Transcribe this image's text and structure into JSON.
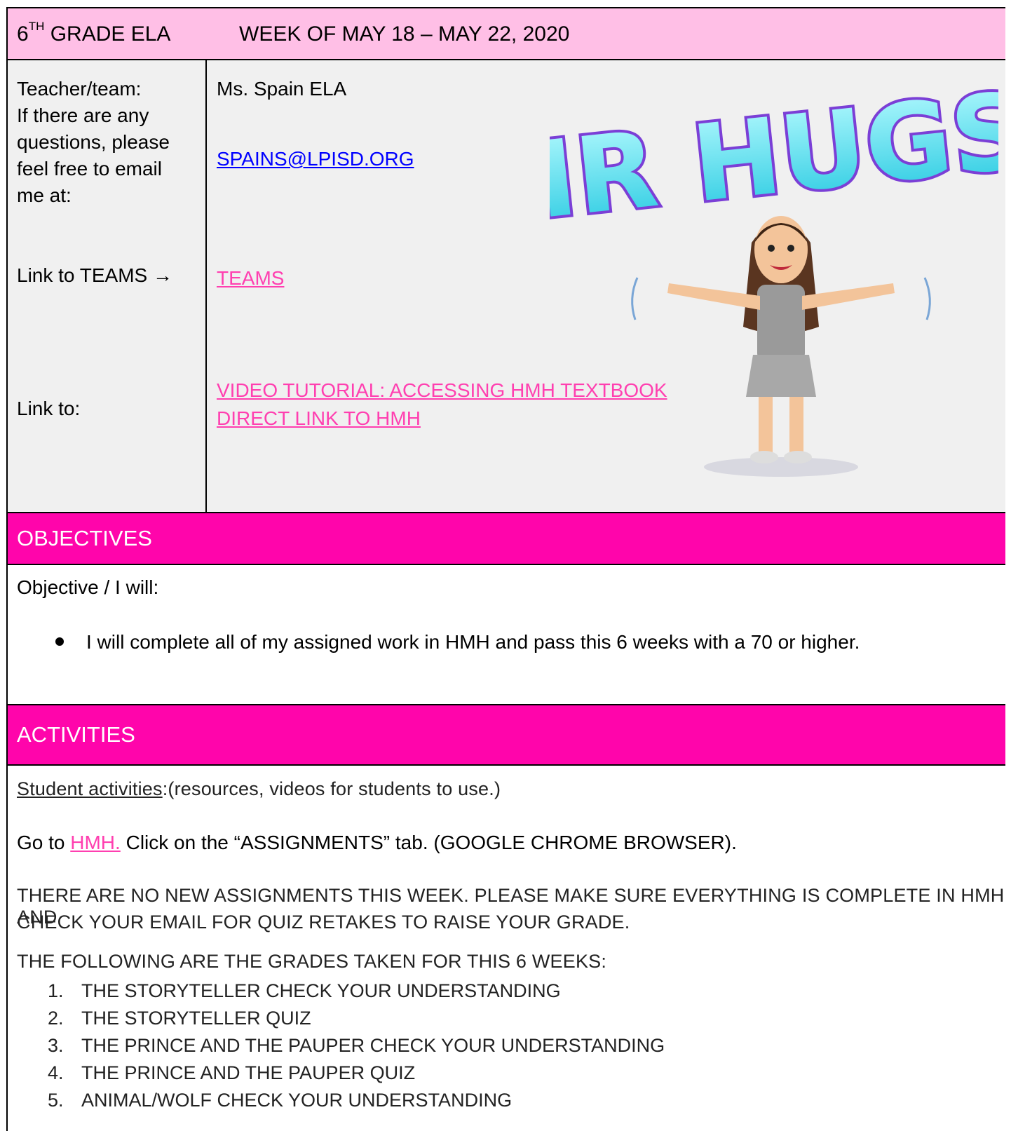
{
  "header": {
    "grade": "6",
    "grade_sup": "TH",
    "grade_rest": " GRADE ELA",
    "week": "WEEK OF MAY 18 – MAY 22, 2020"
  },
  "info": {
    "teacher_label": "Teacher/team:\nIf there are any questions, please feel free to email me at:",
    "teacher_value": "Ms. Spain ELA",
    "email": "SPAINS@LPISD.ORG",
    "teams_label": "Link to TEAMS →",
    "teams_link": "TEAMS",
    "link_to_label": "Link to:",
    "video_link": "VIDEO TUTORIAL: ACCESSING HMH TEXTBOOK",
    "direct_link": "DIRECT LINK TO HMH"
  },
  "sticker": {
    "text": "AIR HUGS!",
    "colors": {
      "letters": "#2fe0e8",
      "outline": "#7b3fd6"
    }
  },
  "objectives": {
    "title": "OBJECTIVES",
    "heading": "Objective / I will:",
    "bullet": "I will complete all of my assigned work in HMH and pass this 6 weeks with a 70 or higher."
  },
  "activities": {
    "title": "ACTIVITIES",
    "student_label": "Student activities",
    "student_rest": ":(resources, videos for students to use.)",
    "goto_pre": "Go to ",
    "goto_link": "HMH.",
    "goto_post": " Click on the “ASSIGNMENTS” tab. (GOOGLE CHROME BROWSER).",
    "notice_line1": "THERE ARE NO NEW ASSIGNMENTS THIS WEEK. PLEASE MAKE SURE EVERYTHING IS COMPLETE IN HMH AND",
    "notice_line2": "CHECK YOUR EMAIL FOR QUIZ RETAKES TO RAISE YOUR GRADE.",
    "grades_intro": "THE FOLLOWING ARE THE GRADES TAKEN FOR THIS 6 WEEKS:",
    "grades": [
      {
        "n": "1.",
        "text": "THE STORYTELLER CHECK YOUR UNDERSTANDING"
      },
      {
        "n": "2.",
        "text": "THE STORYTELLER QUIZ"
      },
      {
        "n": "3.",
        "text": "THE PRINCE AND THE PAUPER CHECK YOUR UNDERSTANDING"
      },
      {
        "n": "4.",
        "text": "THE PRINCE AND THE PAUPER QUIZ"
      },
      {
        "n": "5.",
        "text": "ANIMAL/WOLF CHECK YOUR UNDERSTANDING"
      }
    ]
  },
  "colors": {
    "header_bg": "#ffbfe6",
    "section_bg": "#ff05ab",
    "info_bg": "#f0f0f0",
    "pink_link": "#ff3fb0",
    "blue_link": "#0000ff"
  }
}
